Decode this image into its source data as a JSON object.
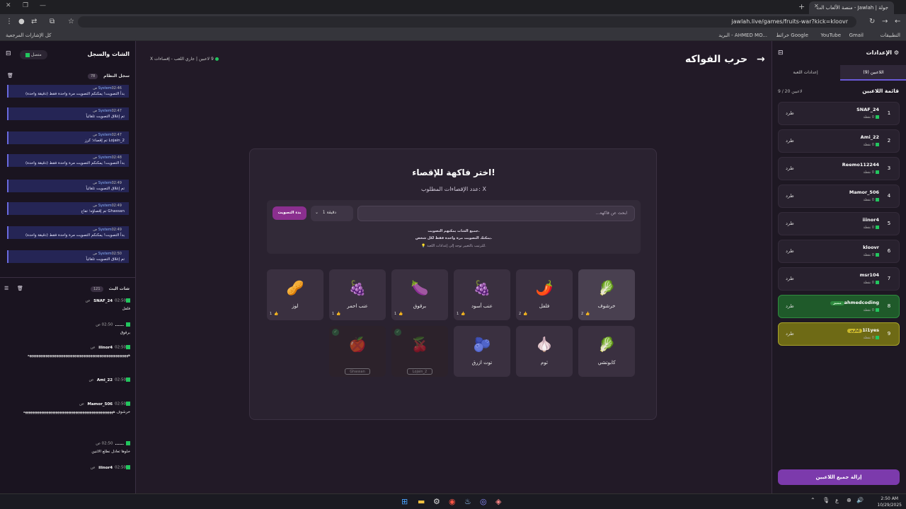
{
  "browser": {
    "tab_title": "جولة | Jawlah - منصة الألعاب الت",
    "url": "jawlah.live/games/fruits-war?kick=kloovr"
  },
  "bookmarks": [
    "التطبيقات",
    "Gmail",
    "YouTube",
    "خرائط Google",
    "البريد - AHMED MO...",
    "كل الإشارات المرجعية"
  ],
  "chat": {
    "title": "الشات والسجل",
    "status": "متصل",
    "system_log_title": "سجل النظام",
    "system_log_count": "78",
    "live_chat_title": "شات البث",
    "live_chat_count": "121"
  },
  "system_messages": [
    {
      "who": "System",
      "time": "02:46 ص",
      "text": "بدأ التصويت! يمكنكم التصويت مرة واحدة فقط (دقيقة واحدة)"
    },
    {
      "who": "System",
      "time": "02:47 ص",
      "text": "تم إغلاق التصويت تلقائياً"
    },
    {
      "who": "System",
      "time": "02:47 ص",
      "text": "Lojain_2 تم إقصاء؛ كرز"
    },
    {
      "who": "System",
      "time": "02:48 ص",
      "text": "بدأ التصويت! يمكنكم التصويت مرة واحدة فقط (دقيقة واحدة)"
    },
    {
      "who": "System",
      "time": "02:49 ص",
      "text": "تم إغلاق التصويت تلقائياً"
    },
    {
      "who": "System",
      "time": "02:49 ص",
      "text": "Ghassan تم إقصاؤه؛ تفاح"
    },
    {
      "who": "System",
      "time": "02:49 ص",
      "text": "بدأ التصويت! يمكنكم التصويت مرة واحدة فقط (دقيقة واحدة)"
    },
    {
      "who": "System",
      "time": "02:50 ص",
      "text": "تم إغلاق التصويت تلقائياً"
    }
  ],
  "live_chat": [
    {
      "name": "SNAF_24",
      "time": "02:50 ص",
      "text": "فلفل"
    },
    {
      "name": "......",
      "time": "02:50 ص",
      "text": "برقوق"
    },
    {
      "name": "iiinor4",
      "time": "02:50 ص",
      "text": "ههههههههههههههههههههههههههههههههههههههههههههههههههههههههه"
    },
    {
      "name": "Ami_22",
      "time": "02:50 ص",
      "text": ""
    },
    {
      "name": "Mamor_506",
      "time": "02:50 ص",
      "text": "خرشوف ههههههههههههههههههههههههههههههههههههههههههههههههههه"
    },
    {
      "name": "......",
      "time": "02:50 ص",
      "text": "خلوها تعادل نطلع الاثنين"
    },
    {
      "name": "iiinor4",
      "time": "02:50 ص",
      "text": ""
    }
  ],
  "game": {
    "title": "حرب الفواكه",
    "players_online": "9 لاعبين",
    "status": "جاري اللعب - إقصاءات X",
    "card_title": "اختر فاكهة للإقصاء!",
    "eliminations_needed": "عدد الإقصاءات المطلوب: X",
    "search_placeholder": "ابحث عن فاكهة...",
    "duration": "1 دقيقة",
    "start_vote": "بدء التصويت",
    "note1": "جميع الشات يمكنهم التصويت.",
    "note2": "يمكنك التصويت مرة واحدة فقط لكل شخص.",
    "note3": "💡 للترتيب بالتغيير توجه إلى إعدادات اللعبة."
  },
  "fruits": [
    {
      "name": "خرشوف",
      "icon": "🥬",
      "count": "2"
    },
    {
      "name": "فلفل",
      "icon": "🌶️",
      "count": "2"
    },
    {
      "name": "عنب أسود",
      "icon": "🍇",
      "count": "1"
    },
    {
      "name": "برقوق",
      "icon": "🍆",
      "count": "1"
    },
    {
      "name": "عنب احمر",
      "icon": "🍇",
      "count": "1"
    },
    {
      "name": "لوز",
      "icon": "🥜",
      "count": "1"
    },
    {
      "name": "كابوتشي",
      "icon": "🥬",
      "count": ""
    },
    {
      "name": "ثوم",
      "icon": "🧄",
      "count": ""
    },
    {
      "name": "توت ازرق",
      "icon": "🫐",
      "count": ""
    },
    {
      "name": "كرز",
      "icon": "🍒",
      "elim_by": "Lojain_2"
    },
    {
      "name": "تفاح",
      "icon": "🍎",
      "elim_by": "Ghassan"
    }
  ],
  "settings": {
    "title": "الإعدادات",
    "tab_players": "اللاعبين (9)",
    "tab_game_settings": "إعدادات اللعبة",
    "list_title": "قائمة اللاعبين",
    "list_count": "9 / 20 لاعبين",
    "kick": "طرد",
    "clear_all": "إزالة جميع اللاعبين"
  },
  "players": [
    {
      "n": "1",
      "name": "SNAF_24",
      "pts": "0 نقطة"
    },
    {
      "n": "2",
      "name": "Ami_22",
      "pts": "0 نقطة"
    },
    {
      "n": "3",
      "name": "Reemo112244",
      "pts": "0 نقطة"
    },
    {
      "n": "4",
      "name": "Mamor_506",
      "pts": "0 نقطة"
    },
    {
      "n": "5",
      "name": "iiinor4",
      "pts": "0 نقطة"
    },
    {
      "n": "6",
      "name": "kloovr",
      "pts": "0 نقطة"
    },
    {
      "n": "7",
      "name": "msr104",
      "pts": "0 نقطة"
    },
    {
      "n": "8",
      "name": "ahmedcoding",
      "pts": "0 نقطة",
      "tag": "مميز"
    },
    {
      "n": "9",
      "name": "1i1yes",
      "pts": "0 نقطة",
      "tag": "إداري"
    }
  ],
  "taskbar": {
    "time": "2:50 AM",
    "date": "10/29/2025"
  }
}
